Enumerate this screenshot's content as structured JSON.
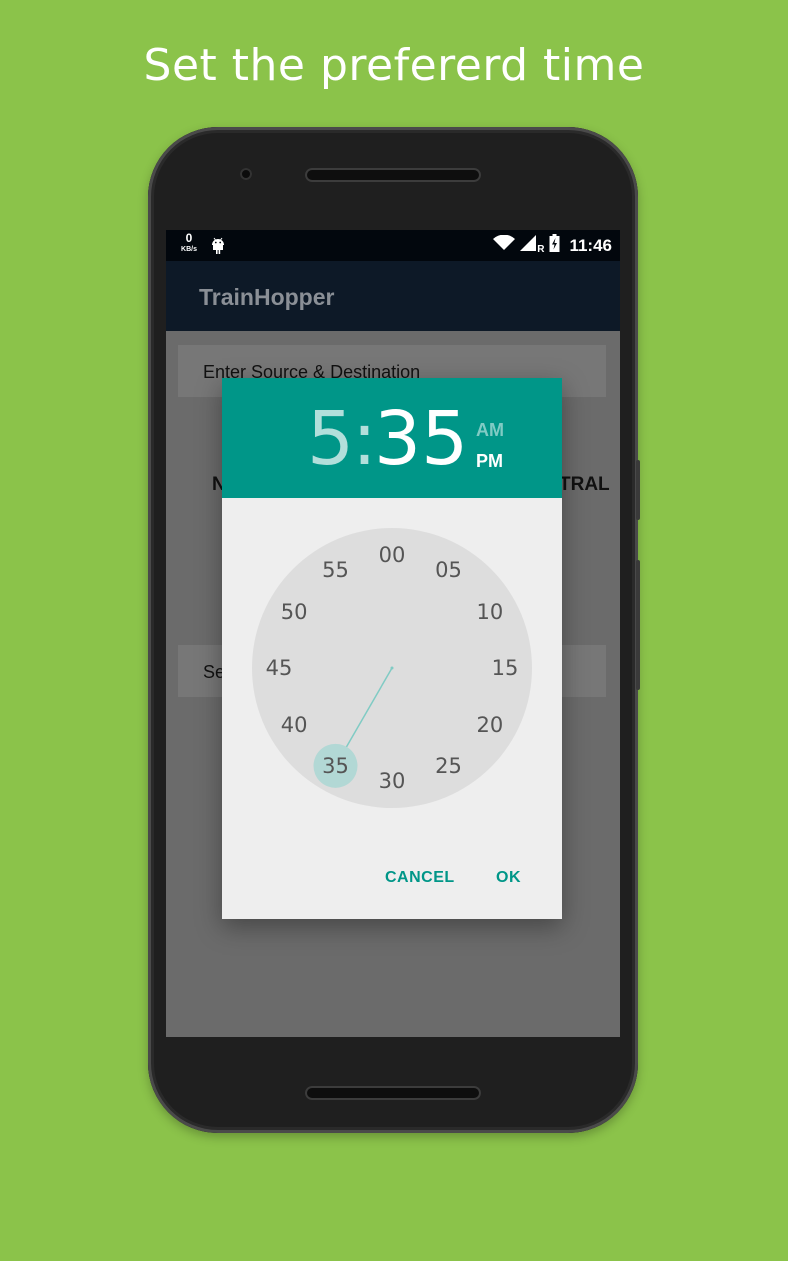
{
  "headline": "Set the prefererd time",
  "status_bar": {
    "net_speed": "0",
    "net_unit": "KB/s",
    "network_label": "R",
    "time": "11:46",
    "icons": [
      "android-icon",
      "wifi-icon",
      "signal-icon",
      "battery-charging-icon"
    ]
  },
  "app": {
    "title": "TrainHopper",
    "source_card_label": "Enter Source & Destination",
    "left_fragment": "N",
    "right_fragment": "TRAL",
    "second_card_fragment": "Se",
    "fab_icon": "search-icon"
  },
  "time_picker": {
    "hour": "5",
    "separator": ":",
    "minute": "35",
    "am_label": "AM",
    "pm_label": "PM",
    "selected_period": "PM",
    "dial_numbers": [
      "00",
      "05",
      "10",
      "15",
      "20",
      "25",
      "30",
      "35",
      "40",
      "45",
      "50",
      "55"
    ],
    "selected_minute": "35",
    "cancel_label": "CANCEL",
    "ok_label": "OK"
  },
  "colors": {
    "background": "#8bc34a",
    "accent": "#009688",
    "appbar": "#0d1927"
  }
}
